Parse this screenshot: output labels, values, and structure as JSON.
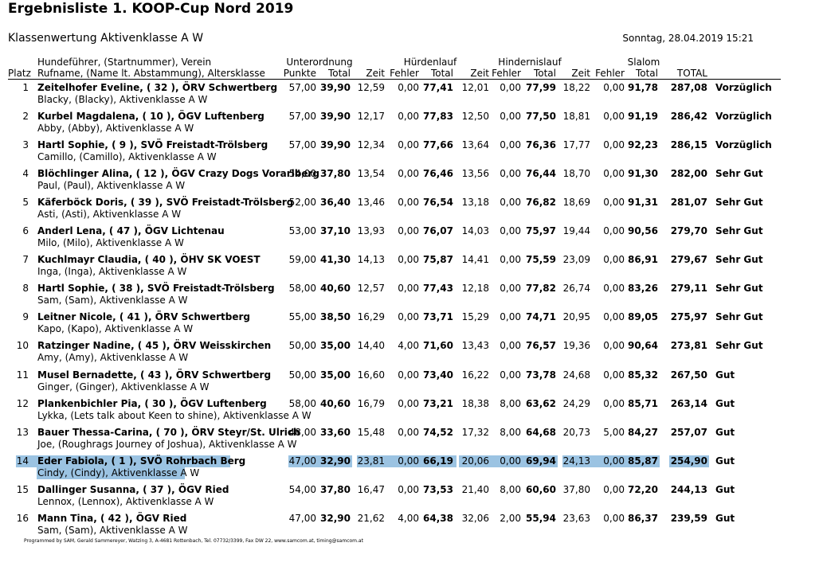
{
  "title": "Ergebnisliste 1. KOOP-Cup Nord 2019",
  "subtitle": "Klassenwertung Aktivenklasse A W",
  "datetime": "Sonntag, 28.04.2019 15:21",
  "headers": {
    "platz": "Platz",
    "handler_line1": "Hundeführer, (Startnummer), Verein",
    "handler_line2": "Rufname, (Name lt. Abstammung), Altersklasse",
    "unterordnung": "Unterordnung",
    "punkte": "Punkte",
    "total": "Total",
    "huerdenlauf": "Hürdenlauf",
    "hindernislauf": "Hindernislauf",
    "slalom": "Slalom",
    "zeit": "Zeit",
    "fehler": "Fehler",
    "grand_total": "TOTAL"
  },
  "rows": [
    {
      "platz": "1",
      "handler": "Zeitelhofer Eveline, ( 32 ), ÖRV Schwertberg",
      "dog": "Blacky, (Blacky), Aktivenklasse A W",
      "punkte": "57,00",
      "uo_total": "39,90",
      "h_zeit": "12,59",
      "h_fehler": "0,00",
      "h_total": "77,41",
      "hi_zeit": "12,01",
      "hi_fehler": "0,00",
      "hi_total": "77,99",
      "s_zeit": "18,22",
      "s_fehler": "0,00",
      "s_total": "91,78",
      "total": "287,08",
      "rating": "Vorzüglich"
    },
    {
      "platz": "2",
      "handler": "Kurbel Magdalena, ( 10 ), ÖGV Luftenberg",
      "dog": "Abby, (Abby), Aktivenklasse A W",
      "punkte": "57,00",
      "uo_total": "39,90",
      "h_zeit": "12,17",
      "h_fehler": "0,00",
      "h_total": "77,83",
      "hi_zeit": "12,50",
      "hi_fehler": "0,00",
      "hi_total": "77,50",
      "s_zeit": "18,81",
      "s_fehler": "0,00",
      "s_total": "91,19",
      "total": "286,42",
      "rating": "Vorzüglich"
    },
    {
      "platz": "3",
      "handler": "Hartl Sophie, ( 9 ), SVÖ Freistadt-Trölsberg",
      "dog": "Camillo, (Camillo), Aktivenklasse A W",
      "punkte": "57,00",
      "uo_total": "39,90",
      "h_zeit": "12,34",
      "h_fehler": "0,00",
      "h_total": "77,66",
      "hi_zeit": "13,64",
      "hi_fehler": "0,00",
      "hi_total": "76,36",
      "s_zeit": "17,77",
      "s_fehler": "0,00",
      "s_total": "92,23",
      "total": "286,15",
      "rating": "Vorzüglich"
    },
    {
      "platz": "4",
      "handler": "Blöchlinger Alina, ( 12 ), ÖGV Crazy Dogs Vorarlberg",
      "dog": "Paul, (Paul), Aktivenklasse A W",
      "punkte": "54,00",
      "uo_total": "37,80",
      "h_zeit": "13,54",
      "h_fehler": "0,00",
      "h_total": "76,46",
      "hi_zeit": "13,56",
      "hi_fehler": "0,00",
      "hi_total": "76,44",
      "s_zeit": "18,70",
      "s_fehler": "0,00",
      "s_total": "91,30",
      "total": "282,00",
      "rating": "Sehr Gut"
    },
    {
      "platz": "5",
      "handler": "Käferböck Doris, ( 39 ), SVÖ Freistadt-Trölsberg",
      "dog": "Asti, (Asti), Aktivenklasse A W",
      "punkte": "52,00",
      "uo_total": "36,40",
      "h_zeit": "13,46",
      "h_fehler": "0,00",
      "h_total": "76,54",
      "hi_zeit": "13,18",
      "hi_fehler": "0,00",
      "hi_total": "76,82",
      "s_zeit": "18,69",
      "s_fehler": "0,00",
      "s_total": "91,31",
      "total": "281,07",
      "rating": "Sehr Gut"
    },
    {
      "platz": "6",
      "handler": "Anderl Lena, ( 47 ), ÖGV Lichtenau",
      "dog": "Milo, (Milo), Aktivenklasse A W",
      "punkte": "53,00",
      "uo_total": "37,10",
      "h_zeit": "13,93",
      "h_fehler": "0,00",
      "h_total": "76,07",
      "hi_zeit": "14,03",
      "hi_fehler": "0,00",
      "hi_total": "75,97",
      "s_zeit": "19,44",
      "s_fehler": "0,00",
      "s_total": "90,56",
      "total": "279,70",
      "rating": "Sehr Gut"
    },
    {
      "platz": "7",
      "handler": "Kuchlmayr Claudia, ( 40 ), ÖHV SK VOEST",
      "dog": "Inga, (Inga), Aktivenklasse A W",
      "punkte": "59,00",
      "uo_total": "41,30",
      "h_zeit": "14,13",
      "h_fehler": "0,00",
      "h_total": "75,87",
      "hi_zeit": "14,41",
      "hi_fehler": "0,00",
      "hi_total": "75,59",
      "s_zeit": "23,09",
      "s_fehler": "0,00",
      "s_total": "86,91",
      "total": "279,67",
      "rating": "Sehr Gut"
    },
    {
      "platz": "8",
      "handler": "Hartl Sophie, ( 38 ), SVÖ Freistadt-Trölsberg",
      "dog": "Sam, (Sam), Aktivenklasse A W",
      "punkte": "58,00",
      "uo_total": "40,60",
      "h_zeit": "12,57",
      "h_fehler": "0,00",
      "h_total": "77,43",
      "hi_zeit": "12,18",
      "hi_fehler": "0,00",
      "hi_total": "77,82",
      "s_zeit": "26,74",
      "s_fehler": "0,00",
      "s_total": "83,26",
      "total": "279,11",
      "rating": "Sehr Gut"
    },
    {
      "platz": "9",
      "handler": "Leitner Nicole, ( 41 ), ÖRV Schwertberg",
      "dog": "Kapo, (Kapo), Aktivenklasse A W",
      "punkte": "55,00",
      "uo_total": "38,50",
      "h_zeit": "16,29",
      "h_fehler": "0,00",
      "h_total": "73,71",
      "hi_zeit": "15,29",
      "hi_fehler": "0,00",
      "hi_total": "74,71",
      "s_zeit": "20,95",
      "s_fehler": "0,00",
      "s_total": "89,05",
      "total": "275,97",
      "rating": "Sehr Gut"
    },
    {
      "platz": "10",
      "handler": "Ratzinger Nadine, ( 45 ), ÖRV Weisskirchen",
      "dog": "Amy, (Amy), Aktivenklasse A W",
      "punkte": "50,00",
      "uo_total": "35,00",
      "h_zeit": "14,40",
      "h_fehler": "4,00",
      "h_total": "71,60",
      "hi_zeit": "13,43",
      "hi_fehler": "0,00",
      "hi_total": "76,57",
      "s_zeit": "19,36",
      "s_fehler": "0,00",
      "s_total": "90,64",
      "total": "273,81",
      "rating": "Sehr Gut"
    },
    {
      "platz": "11",
      "handler": "Musel Bernadette, ( 43 ), ÖRV Schwertberg",
      "dog": "Ginger, (Ginger), Aktivenklasse A W",
      "punkte": "50,00",
      "uo_total": "35,00",
      "h_zeit": "16,60",
      "h_fehler": "0,00",
      "h_total": "73,40",
      "hi_zeit": "16,22",
      "hi_fehler": "0,00",
      "hi_total": "73,78",
      "s_zeit": "24,68",
      "s_fehler": "0,00",
      "s_total": "85,32",
      "total": "267,50",
      "rating": "Gut"
    },
    {
      "platz": "12",
      "handler": "Plankenbichler Pia, ( 30 ), ÖGV Luftenberg",
      "dog": "Lykka, (Lets talk about Keen to shine), Aktivenklasse A W",
      "punkte": "58,00",
      "uo_total": "40,60",
      "h_zeit": "16,79",
      "h_fehler": "0,00",
      "h_total": "73,21",
      "hi_zeit": "18,38",
      "hi_fehler": "8,00",
      "hi_total": "63,62",
      "s_zeit": "24,29",
      "s_fehler": "0,00",
      "s_total": "85,71",
      "total": "263,14",
      "rating": "Gut"
    },
    {
      "platz": "13",
      "handler": "Bauer Thessa-Carina, ( 70 ), ÖRV Steyr/St. Ulrich",
      "dog": "Joe, (Roughrags Journey of Joshua), Aktivenklasse A W",
      "punkte": "48,00",
      "uo_total": "33,60",
      "h_zeit": "15,48",
      "h_fehler": "0,00",
      "h_total": "74,52",
      "hi_zeit": "17,32",
      "hi_fehler": "8,00",
      "hi_total": "64,68",
      "s_zeit": "20,73",
      "s_fehler": "5,00",
      "s_total": "84,27",
      "total": "257,07",
      "rating": "Gut"
    },
    {
      "platz": "14",
      "handler": "Eder Fabiola, ( 1 ), SVÖ Rohrbach Berg",
      "dog": "Cindy, (Cindy), Aktivenklasse A W",
      "punkte": "47,00",
      "uo_total": "32,90",
      "h_zeit": "23,81",
      "h_fehler": "0,00",
      "h_total": "66,19",
      "hi_zeit": "20,06",
      "hi_fehler": "0,00",
      "hi_total": "69,94",
      "s_zeit": "24,13",
      "s_fehler": "0,00",
      "s_total": "85,87",
      "total": "254,90",
      "rating": "Gut",
      "highlight": true
    },
    {
      "platz": "15",
      "handler": "Dallinger Susanna, ( 37 ), ÖGV Ried",
      "dog": "Lennox, (Lennox), Aktivenklasse A W",
      "punkte": "54,00",
      "uo_total": "37,80",
      "h_zeit": "16,47",
      "h_fehler": "0,00",
      "h_total": "73,53",
      "hi_zeit": "21,40",
      "hi_fehler": "8,00",
      "hi_total": "60,60",
      "s_zeit": "37,80",
      "s_fehler": "0,00",
      "s_total": "72,20",
      "total": "244,13",
      "rating": "Gut"
    },
    {
      "platz": "16",
      "handler": "Mann Tina, ( 42 ), ÖGV Ried",
      "dog": "Sam, (Sam), Aktivenklasse A W",
      "punkte": "47,00",
      "uo_total": "32,90",
      "h_zeit": "21,62",
      "h_fehler": "4,00",
      "h_total": "64,38",
      "hi_zeit": "32,06",
      "hi_fehler": "2,00",
      "hi_total": "55,94",
      "s_zeit": "23,63",
      "s_fehler": "0,00",
      "s_total": "86,37",
      "total": "239,59",
      "rating": "Gut"
    }
  ],
  "footer": "Programmed by SAM, Gerald Sammereyer, Watzing 3, A-4681 Rottenbach, Tel. 07732/3399, Fax DW 22, www.samcom.at, timing@samcom.at",
  "colors": {
    "highlight": "#9bc3e2"
  }
}
